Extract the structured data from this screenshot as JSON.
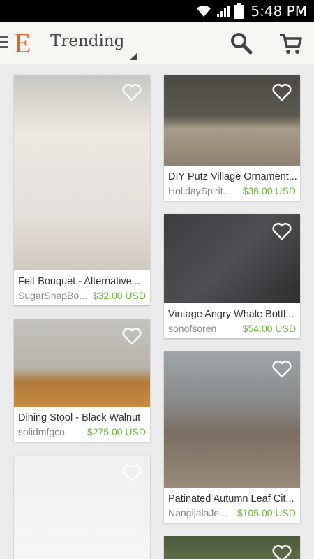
{
  "status_bar": {
    "time": "5:48 PM"
  },
  "action_bar": {
    "logo": "E",
    "title": "Trending"
  },
  "listings": [
    {
      "name": "Felt Bouquet  - Alternative...",
      "shop": "SugarSnapBo...",
      "price": "$32.00 USD"
    },
    {
      "name": "DIY Putz Village Ornament...",
      "shop": "HolidaySpirit...",
      "price": "$36.00 USD"
    },
    {
      "name": "Vintage Angry Whale Bottl...",
      "shop": "sonofsoren",
      "price": "$54.00 USD"
    },
    {
      "name": "Dining Stool - Black Walnut",
      "shop": "solidmfgco",
      "price": "$275.00 USD"
    },
    {
      "name": "Patinated Autumn Leaf Cit...",
      "shop": "NangijalaJe...",
      "price": "$105.00 USD"
    }
  ],
  "colors": {
    "accent": "#e2622a",
    "price": "#6cb33e",
    "background": "#ebebeb"
  }
}
